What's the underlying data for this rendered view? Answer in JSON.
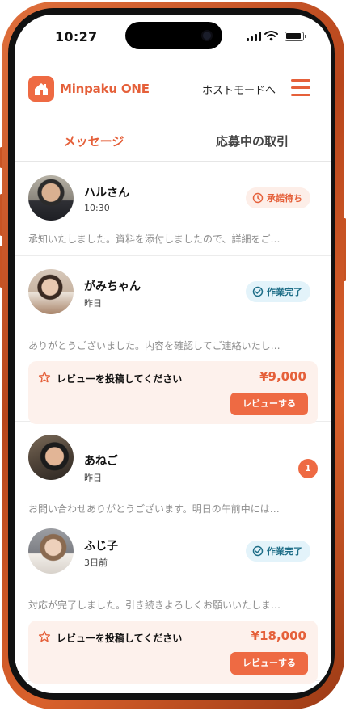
{
  "status_bar": {
    "time": "10:27"
  },
  "header": {
    "app_name": "Minpaku ONE",
    "host_mode_link": "ホストモードへ"
  },
  "tabs": [
    {
      "label": "メッセージ",
      "active": true
    },
    {
      "label": "応募中の取引",
      "active": false
    }
  ],
  "conversations": [
    {
      "name": "ハルさん",
      "time": "10:30",
      "status": "承諾待ち",
      "preview": "承知いたしました。資料を添付しましたので、詳細をご…"
    },
    {
      "name": "がみちゃん",
      "time": "昨日",
      "status": "作業完了",
      "preview": "ありがとうございました。内容を確認してご連絡いたし…",
      "review": {
        "prompt": "レビューを投稿してください",
        "amount": "¥9,000",
        "button": "レビューする"
      }
    },
    {
      "name": "あねご",
      "time": "昨日",
      "unread": "1",
      "preview": "お問い合わせありがとうございます。明日の午前中には…"
    },
    {
      "name": "ふじ子",
      "time": "3日前",
      "status": "作業完了",
      "preview": "対応が完了しました。引き続きよろしくお願いいたしま…",
      "review": {
        "prompt": "レビューを投稿してください",
        "amount": "¥18,000",
        "button": "レビューする"
      }
    }
  ],
  "colors": {
    "accent": "#ee6a43",
    "pending_bg": "#fdeee8",
    "done_bg": "#e3f3fa",
    "done_text": "#1d6d87",
    "frame": "#c75323"
  },
  "icons": {
    "logo": "house-icon",
    "menu": "hamburger-icon",
    "pending": "clock-icon",
    "done": "check-circle-icon",
    "review": "star-icon"
  }
}
